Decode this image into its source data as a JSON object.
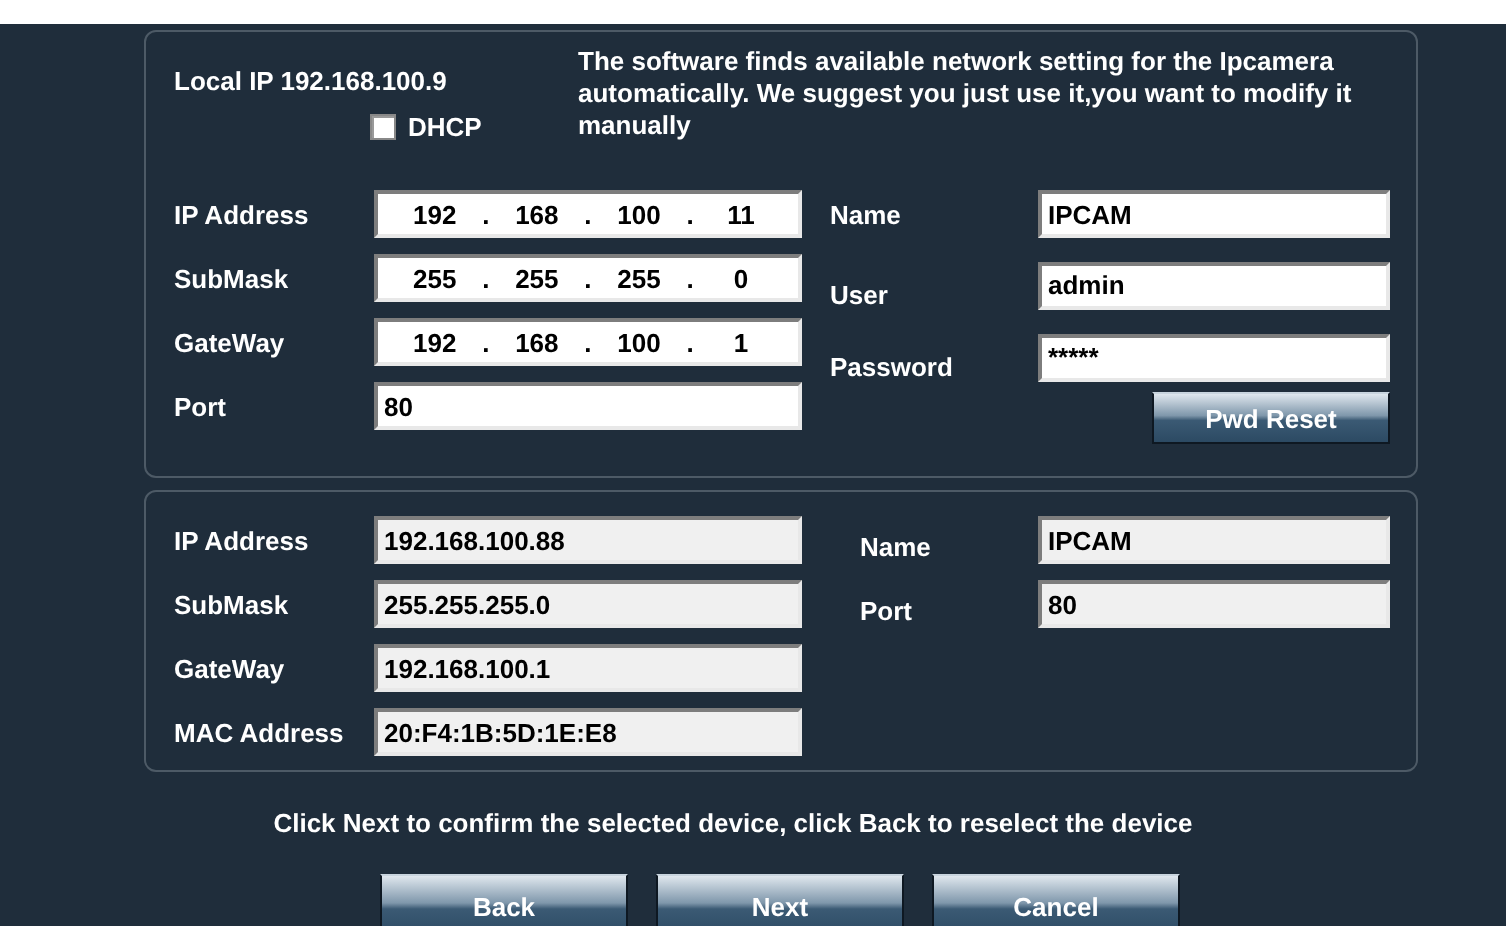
{
  "header": {
    "local_ip": "Local IP 192.168.100.9",
    "dhcp": {
      "label": "DHCP",
      "checked": false
    },
    "notice": "The software finds available network setting for the Ipcamera automatically. We suggest you just use it,you want to modify it manually"
  },
  "settings": {
    "separator": ".",
    "left": [
      {
        "label": "IP Address",
        "kind": "ip",
        "segments": [
          "192",
          "168",
          "100",
          "11"
        ]
      },
      {
        "label": "SubMask",
        "kind": "ip",
        "segments": [
          "255",
          "255",
          "255",
          "0"
        ]
      },
      {
        "label": "GateWay",
        "kind": "ip",
        "segments": [
          "192",
          "168",
          "100",
          "1"
        ]
      },
      {
        "label": "Port",
        "kind": "text",
        "value": "80"
      }
    ],
    "right": [
      {
        "label": "Name",
        "value": "IPCAM"
      },
      {
        "label": "User",
        "value": "admin"
      },
      {
        "label": "Password",
        "value": "*****"
      }
    ],
    "reset_button": "Pwd Reset"
  },
  "device": {
    "left": [
      {
        "label": "IP Address",
        "value": "192.168.100.88"
      },
      {
        "label": "SubMask",
        "value": "255.255.255.0"
      },
      {
        "label": "GateWay",
        "value": "192.168.100.1"
      },
      {
        "label": "MAC Address",
        "value": "20:F4:1B:5D:1E:E8"
      }
    ],
    "right": [
      {
        "label": "Name",
        "value": "IPCAM"
      },
      {
        "label": "Port",
        "value": "80"
      }
    ]
  },
  "hint": "Click Next to confirm the selected device, click Back to reselect the device",
  "buttons": [
    "Back",
    "Next",
    "Cancel"
  ]
}
